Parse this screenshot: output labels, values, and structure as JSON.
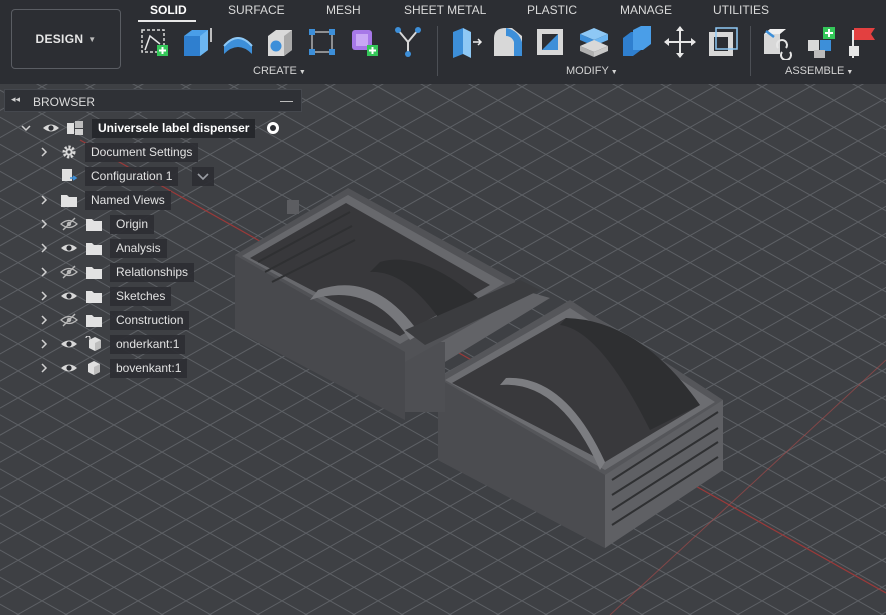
{
  "workspace_button": {
    "label": "DESIGN"
  },
  "tabs": [
    {
      "label": "SOLID",
      "active": true
    },
    {
      "label": "SURFACE"
    },
    {
      "label": "MESH"
    },
    {
      "label": "SHEET METAL"
    },
    {
      "label": "PLASTIC"
    },
    {
      "label": "MANAGE"
    },
    {
      "label": "UTILITIES"
    }
  ],
  "groups": {
    "create": {
      "label": "CREATE",
      "tools": [
        "create-sketch-icon",
        "extrude-icon",
        "revolve-icon",
        "hole-icon",
        "rectangular-pattern-icon",
        "new-component-icon",
        "derive-icon"
      ]
    },
    "modify": {
      "label": "MODIFY",
      "tools": [
        "press-pull-icon",
        "fillet-icon",
        "shell-icon",
        "combine-icon",
        "offset-faces-icon",
        "move-copy-icon",
        "scale-icon"
      ]
    },
    "assemble": {
      "label": "ASSEMBLE",
      "tools": [
        "joint-icon",
        "new-component-assemble-icon",
        "ground-icon"
      ]
    }
  },
  "browser": {
    "title": "BROWSER",
    "root": {
      "label": "Universele label dispenser"
    },
    "items": [
      {
        "label": "Document Settings",
        "icon": "gear-icon"
      },
      {
        "label": "Configuration 1",
        "icon": "configuration-icon"
      },
      {
        "label": "Named Views",
        "icon": "folder-icon"
      },
      {
        "label": "Origin",
        "icon": "folder-icon",
        "visibility": "hidden"
      },
      {
        "label": "Analysis",
        "icon": "folder-icon",
        "visibility": "visible"
      },
      {
        "label": "Relationships",
        "icon": "folder-icon",
        "visibility": "hidden"
      },
      {
        "label": "Sketches",
        "icon": "folder-icon",
        "visibility": "visible"
      },
      {
        "label": "Construction",
        "icon": "folder-icon",
        "visibility": "hidden"
      },
      {
        "label": "onderkant:1",
        "icon": "component-icon",
        "visibility": "visible"
      },
      {
        "label": "bovenkant:1",
        "icon": "component-icon",
        "visibility": "visible"
      }
    ]
  },
  "colors": {
    "toolbar_bg": "#2c2e33",
    "canvas_bg": "#3d3f43",
    "grid": "#6a6d72",
    "axis_red": "#a53a3a",
    "model": "#5c5d60",
    "accent_blue": "#3d8fd9"
  }
}
